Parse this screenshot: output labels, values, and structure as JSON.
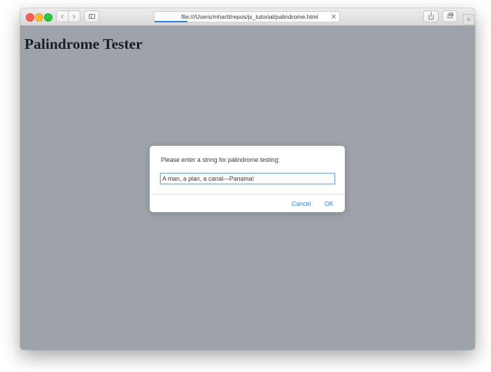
{
  "browser": {
    "address_url": "file:///Users/mhartl/repos/js_tutorial/palindrome.html",
    "traffic_light_colors": {
      "close": "#ff5f57",
      "minimize": "#ffbd2e",
      "maximize": "#28c940"
    },
    "toolbar_icons": {
      "back": "‹",
      "forward": "›",
      "stop": "×",
      "new_tab": "+"
    }
  },
  "page": {
    "title": "Palindrome Tester",
    "background_color": "#9ca3ab"
  },
  "dialog": {
    "message": "Please enter a string for palindrome testing:",
    "input_value": "A man, a plan, a canal—Panama!",
    "cancel_label": "Cancel",
    "ok_label": "OK",
    "accent_color": "#2f87d6"
  }
}
